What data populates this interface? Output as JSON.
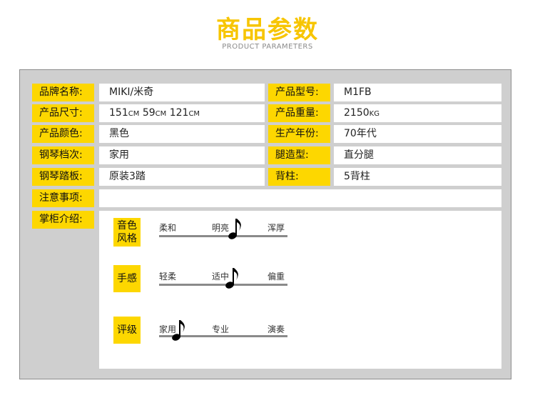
{
  "header": {
    "title": "商品参数",
    "subtitle": "Product parameters"
  },
  "specs": {
    "brand_label": "品牌名称:",
    "brand_value": "MIKI/米奇",
    "model_label": "产品型号:",
    "model_value": "M1FB",
    "size_label": "产品尺寸:",
    "size_num1": "151",
    "size_num2": "59",
    "size_num3": "121",
    "size_unit": "CM",
    "weight_label": "产品重量:",
    "weight_num": "2150",
    "weight_unit": "KG",
    "color_label": "产品颜色:",
    "color_value": "黑色",
    "year_label": "生产年份:",
    "year_value": "70年代",
    "grade_label": "钢琴档次:",
    "grade_value": "家用",
    "leg_label": "腿造型:",
    "leg_value": "直分腿",
    "pedal_label": "钢琴踏板:",
    "pedal_value": "原装3踏",
    "pillar_label": "背柱:",
    "pillar_value": "5背柱",
    "notes_label": "注意事项:",
    "notes_value": "",
    "intro_label": "掌柜介绍:"
  },
  "features": [
    {
      "tag_line1": "音色",
      "tag_line2": "风格",
      "levels": [
        "柔和",
        "明亮",
        "浑厚"
      ],
      "selected": "明亮",
      "selected_index": 1
    },
    {
      "tag_line1": "手感",
      "tag_line2": "",
      "levels": [
        "轻柔",
        "适中",
        "偏重"
      ],
      "selected": "适中",
      "selected_index": 1
    },
    {
      "tag_line1": "评级",
      "tag_line2": "",
      "levels": [
        "家用",
        "专业",
        "演奏"
      ],
      "selected": "家用",
      "selected_index": 0
    }
  ],
  "colors": {
    "accent": "#fdd700",
    "title": "#f7c500",
    "panel": "#cfcfcf"
  },
  "icons": {
    "marker": "music-note-icon"
  }
}
